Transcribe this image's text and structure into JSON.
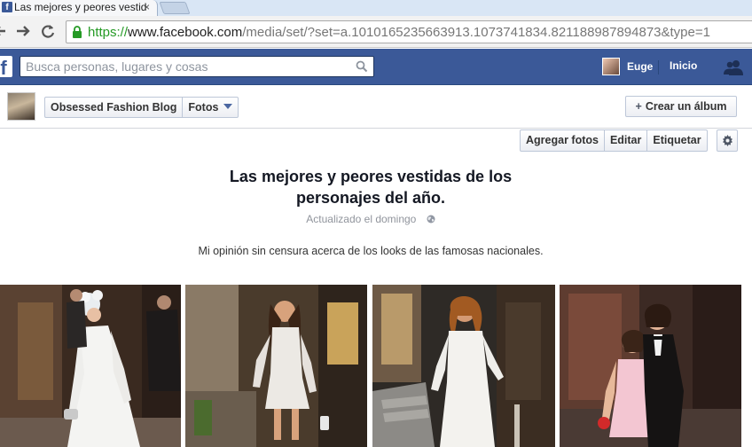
{
  "browser": {
    "tab_title": "Las mejores y peores vestid",
    "tab_close": "×",
    "url_scheme": "https://",
    "url_domain": "www.facebook.com",
    "url_path": "/media/set/?set=a.1010165235663913.1073741834.821188987894873&type=1"
  },
  "fb": {
    "logo": "f",
    "search_placeholder": "Busca personas, lugares y cosas",
    "user_name": "Euge",
    "home_label": "Inicio"
  },
  "page": {
    "name": "Obsessed Fashion Blog",
    "section": "Fotos",
    "create_album": "Crear un álbum",
    "create_album_symbol": "+"
  },
  "album": {
    "actions": [
      "Agregar fotos",
      "Editar",
      "Etiquetar"
    ],
    "title_line1": "Las mejores y peores vestidas de los",
    "title_line2": "personajes del año.",
    "updated": "Actualizado el domingo",
    "description": "Mi opinión sin censura acerca de los looks de las famosas nacionales."
  },
  "icons": {
    "lock": "lock-icon",
    "search": "search-icon",
    "friends": "friends-icon",
    "gear": "gear-icon",
    "globe": "globe-icon"
  },
  "colors": {
    "fb_blue": "#3b5998",
    "https_green": "#259a25"
  }
}
